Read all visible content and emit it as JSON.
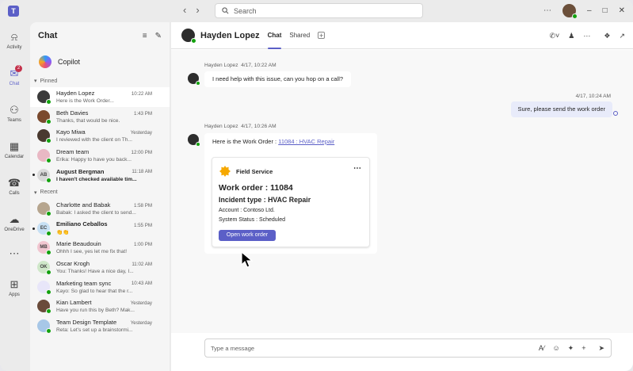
{
  "titlebar": {
    "search_placeholder": "Search",
    "icons": [
      "teams-logo",
      "back-arrow",
      "forward-arrow",
      "search-icon",
      "more-icon",
      "minimize-icon",
      "maximize-icon",
      "close-icon"
    ]
  },
  "rail": [
    {
      "label": "Activity",
      "icon": "bell-icon"
    },
    {
      "label": "Chat",
      "icon": "chat-icon",
      "badge": "2",
      "active": true
    },
    {
      "label": "Teams",
      "icon": "teams-icon"
    },
    {
      "label": "Calendar",
      "icon": "calendar-icon"
    },
    {
      "label": "Calls",
      "icon": "phone-icon"
    },
    {
      "label": "OneDrive",
      "icon": "cloud-icon"
    },
    {
      "label": "",
      "icon": "more-icon"
    },
    {
      "label": "Apps",
      "icon": "plus-icon"
    }
  ],
  "sidebar": {
    "title": "Chat",
    "copilot_label": "Copilot",
    "pinned_label": "Pinned",
    "recent_label": "Recent",
    "pinned": [
      {
        "name": "Hayden Lopez",
        "preview": "Here is the Work Order...",
        "time": "10:22 AM",
        "selected": true,
        "bold": false,
        "unread": false,
        "avatar_color": "#3b3b3b",
        "initials": ""
      },
      {
        "name": "Beth Davies",
        "preview": "Thanks, that would be nice.",
        "time": "1:43 PM",
        "selected": false,
        "bold": false,
        "unread": false,
        "avatar_color": "#7a4a2e",
        "initials": ""
      },
      {
        "name": "Kayo Miwa",
        "preview": "I reviewed with the client on Th...",
        "time": "Yesterday",
        "selected": false,
        "bold": false,
        "unread": false,
        "avatar_color": "#4a3a30",
        "initials": ""
      },
      {
        "name": "Dream team",
        "preview": "Erika: Happy to have you back...",
        "time": "12:00 PM",
        "selected": false,
        "bold": false,
        "unread": false,
        "avatar_color": "#e9b8c4",
        "initials": ""
      },
      {
        "name": "August Bergman",
        "preview": "I haven't checked available tim...",
        "time": "11:18 AM",
        "selected": false,
        "bold": true,
        "unread": true,
        "avatar_color": "#d9d9d9",
        "initials": "AB"
      }
    ],
    "recent": [
      {
        "name": "Charlotte and Babak",
        "preview": "Babak: I asked the client to send...",
        "time": "1:58 PM",
        "selected": false,
        "bold": false,
        "unread": false,
        "avatar_color": "#b6a58e",
        "initials": ""
      },
      {
        "name": "Emiliano Ceballos",
        "preview": "👏👏",
        "time": "1:55 PM",
        "selected": false,
        "bold": true,
        "unread": true,
        "avatar_color": "#c7e0f4",
        "initials": "EC"
      },
      {
        "name": "Marie Beaudouin",
        "preview": "Ohhh I see, yes let me fix that!",
        "time": "1:00 PM",
        "selected": false,
        "bold": false,
        "unread": false,
        "avatar_color": "#f1c6d0",
        "initials": "MB"
      },
      {
        "name": "Oscar Krogh",
        "preview": "You: Thanks! Have a nice day, I...",
        "time": "11:02 AM",
        "selected": false,
        "bold": false,
        "unread": false,
        "avatar_color": "#cfe7c9",
        "initials": "OK"
      },
      {
        "name": "Marketing team sync",
        "preview": "Kayo: So glad to hear that the r...",
        "time": "10:43 AM",
        "selected": false,
        "bold": false,
        "unread": false,
        "avatar_color": "#e8e6f9",
        "initials": ""
      },
      {
        "name": "Kian Lambert",
        "preview": "Have you run this by Beth? Mak...",
        "time": "Yesterday",
        "selected": false,
        "bold": false,
        "unread": false,
        "avatar_color": "#6a4b3a",
        "initials": ""
      },
      {
        "name": "Team Design Template",
        "preview": "Reta: Let's set up a brainstormi...",
        "time": "Yesterday",
        "selected": false,
        "bold": false,
        "unread": false,
        "avatar_color": "#a7c7e7",
        "initials": ""
      }
    ]
  },
  "conversation": {
    "name": "Hayden Lopez",
    "tabs": [
      "Chat",
      "Shared"
    ],
    "msg1": {
      "sender": "Hayden Lopez",
      "time": "4/17, 10:22 AM",
      "text": "I need help with this issue, can you hop on a call?"
    },
    "msg2": {
      "time": "4/17, 10:24 AM",
      "text": "Sure, please send the work order"
    },
    "msg3": {
      "sender": "Hayden Lopez",
      "time": "4/17, 10:26 AM",
      "text_prefix": "Here is the Work Order : ",
      "link": "11084 : HVAC Repair"
    },
    "card": {
      "app": "Field Service",
      "work_order": "Work order : 11084",
      "incident": "Incident type : HVAC Repair",
      "account": "Account : Contoso Ltd.",
      "status": "System Status : Scheduled",
      "button": "Open work order"
    },
    "compose_placeholder": "Type a message"
  }
}
